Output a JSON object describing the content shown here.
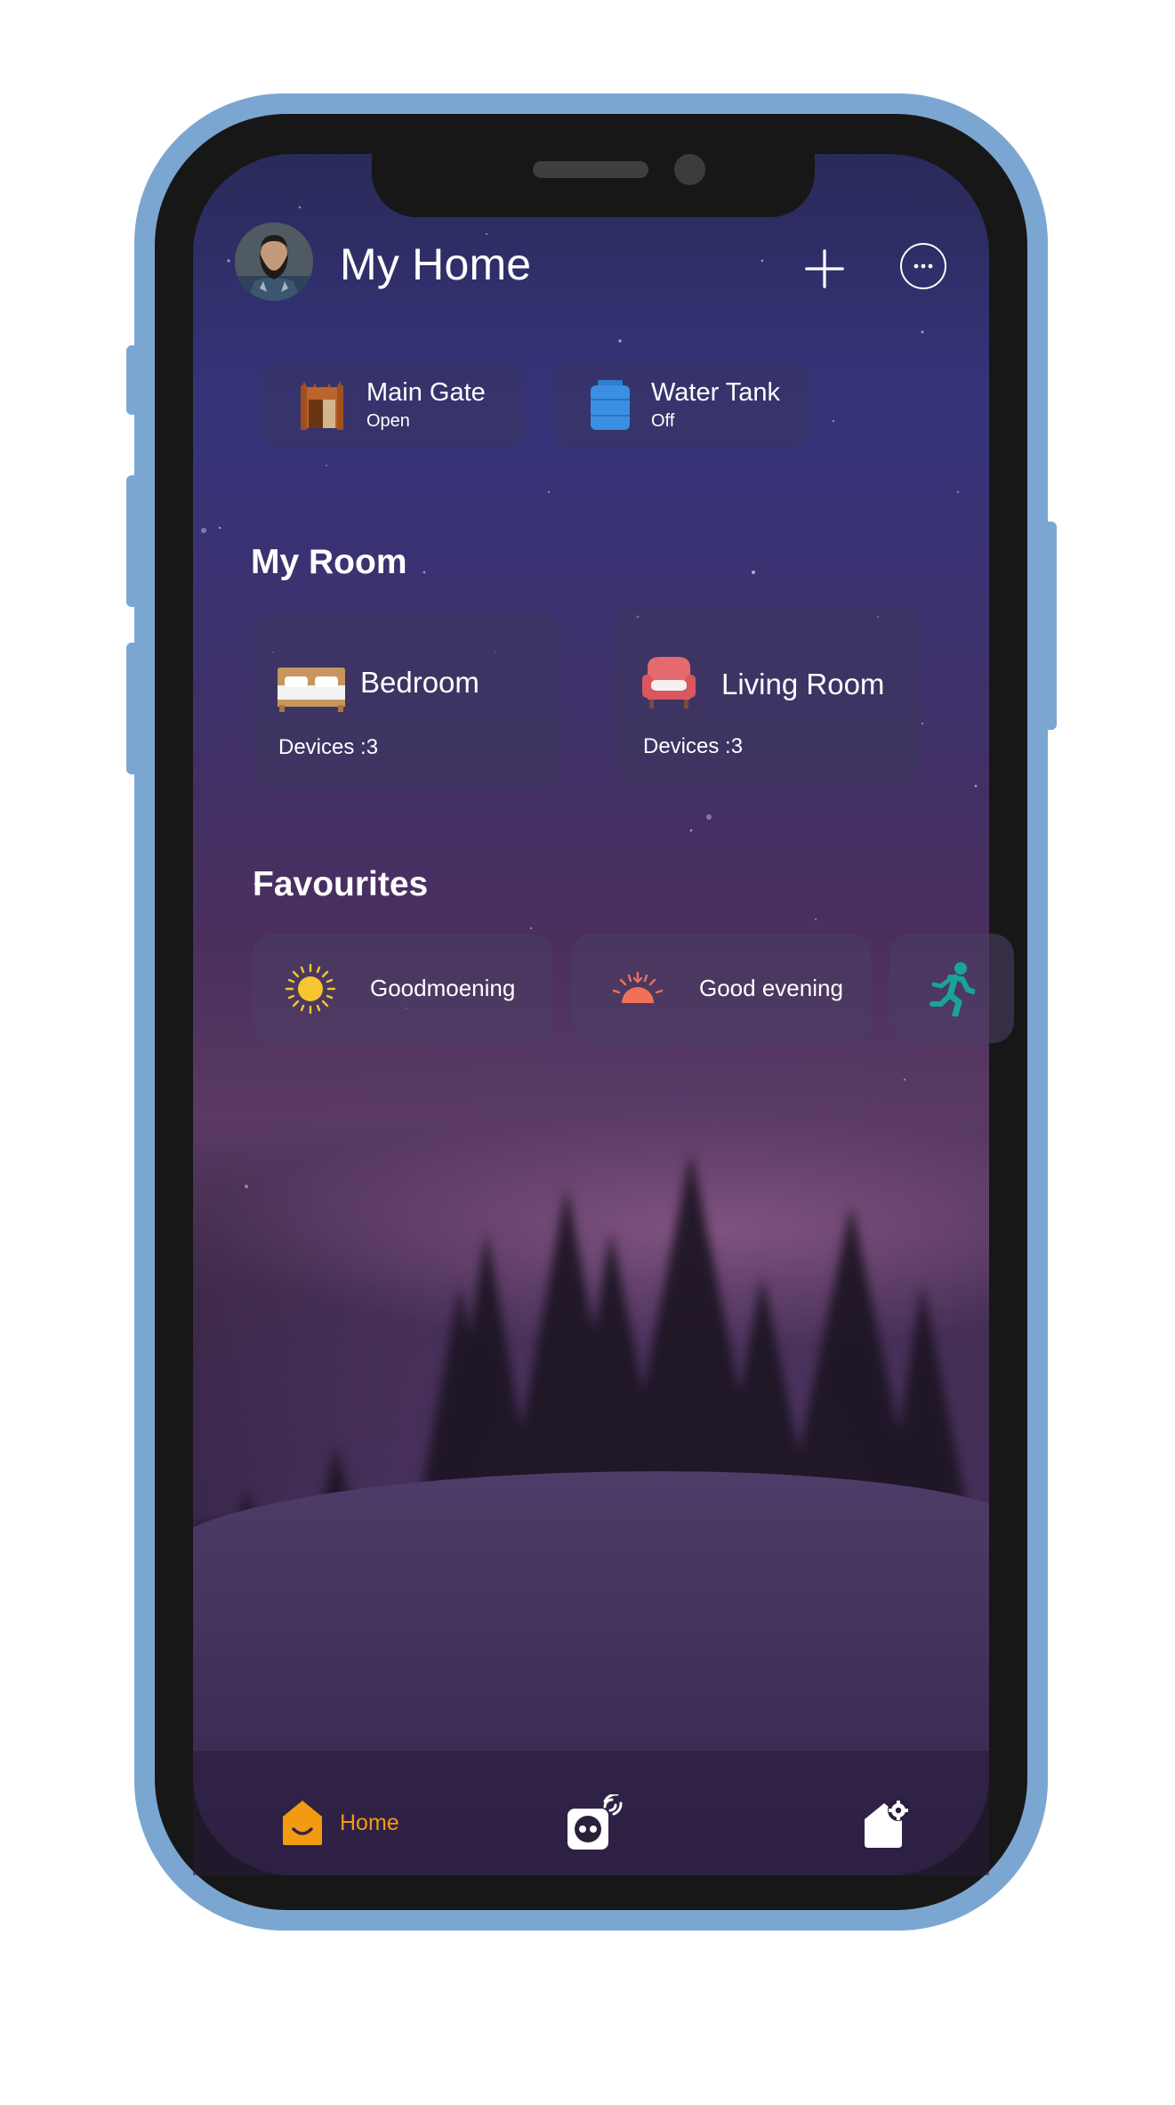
{
  "header": {
    "title": "My Home",
    "avatar_icon": "user-avatar",
    "add_icon": "plus-icon",
    "more_icon": "more-horizontal-icon"
  },
  "quick_devices": [
    {
      "name": "Main Gate",
      "status": "Open",
      "icon": "gate-icon"
    },
    {
      "name": "Water Tank",
      "status": "Off",
      "icon": "water-tank-icon"
    }
  ],
  "rooms": {
    "title": "My Room",
    "items": [
      {
        "name": "Bedroom",
        "devices": "Devices :3",
        "icon": "bed-icon"
      },
      {
        "name": "Living Room",
        "devices": "Devices :3",
        "icon": "armchair-icon"
      }
    ]
  },
  "favourites": {
    "title": "Favourites",
    "items": [
      {
        "label": "Goodmoening",
        "icon": "sun-icon"
      },
      {
        "label": "Good evening",
        "icon": "sunset-icon"
      },
      {
        "label": "",
        "icon": "motion-icon"
      }
    ]
  },
  "bottom_nav": {
    "items": [
      {
        "label": "Home",
        "icon": "home-icon",
        "active": true
      },
      {
        "label": "",
        "icon": "smart-plug-icon",
        "active": false
      },
      {
        "label": "",
        "icon": "home-settings-icon",
        "active": false
      }
    ]
  },
  "colors": {
    "accent": "#f29a12",
    "text": "#ffffff",
    "device_frame": "#7ba6d1"
  }
}
